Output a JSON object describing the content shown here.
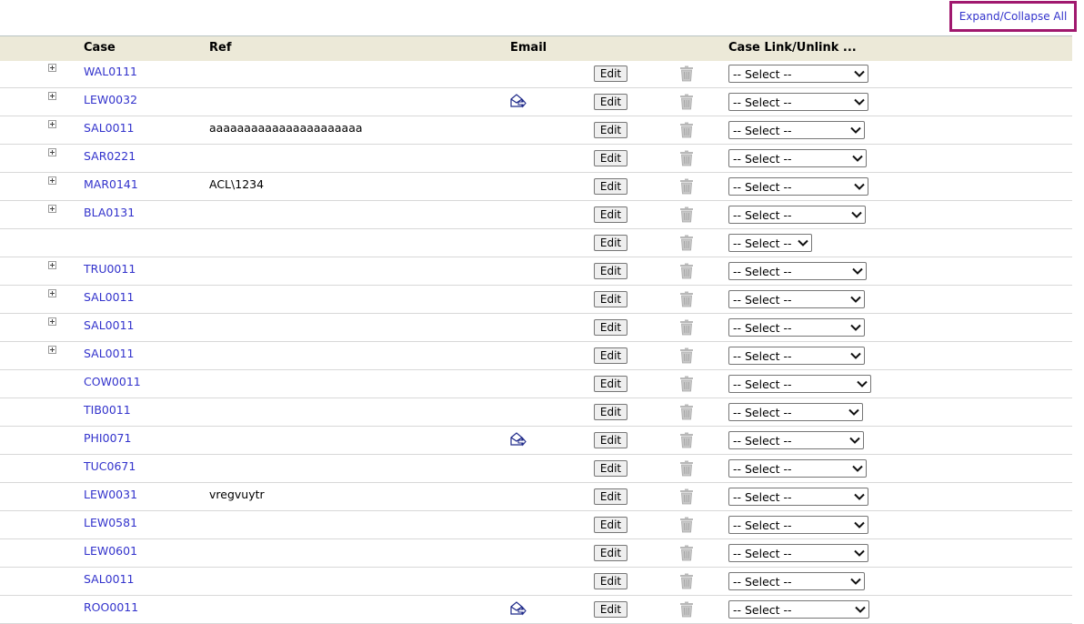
{
  "toolbar": {
    "expand_collapse_label": "Expand/Collapse All"
  },
  "table": {
    "headers": {
      "case": "Case",
      "ref": "Ref",
      "email": "Email",
      "link": "Case Link/Unlink ..."
    },
    "edit_label": "Edit",
    "select_label": "-- Select --",
    "rows": [
      {
        "case": "WAL0111",
        "ref": "",
        "expander": true,
        "email": false
      },
      {
        "case": "LEW0032",
        "ref": "",
        "expander": true,
        "email": true
      },
      {
        "case": "SAL0011",
        "ref": "aaaaaaaaaaaaaaaaaaaaaa",
        "expander": true,
        "email": false
      },
      {
        "case": "SAR0221",
        "ref": "",
        "expander": true,
        "email": false
      },
      {
        "case": "MAR0141",
        "ref": "ACL\\1234",
        "expander": true,
        "email": false
      },
      {
        "case": "BLA0131",
        "ref": "",
        "expander": true,
        "email": false
      },
      {
        "case": "",
        "ref": "",
        "expander": false,
        "email": false
      },
      {
        "case": "TRU0011",
        "ref": "",
        "expander": true,
        "email": false
      },
      {
        "case": "SAL0011",
        "ref": "",
        "expander": true,
        "email": false
      },
      {
        "case": "SAL0011",
        "ref": "",
        "expander": true,
        "email": false
      },
      {
        "case": "SAL0011",
        "ref": "",
        "expander": true,
        "email": false
      },
      {
        "case": "COW0011",
        "ref": "",
        "expander": false,
        "email": false
      },
      {
        "case": "TIB0011",
        "ref": "",
        "expander": false,
        "email": false
      },
      {
        "case": "PHI0071",
        "ref": "",
        "expander": false,
        "email": true
      },
      {
        "case": "TUC0671",
        "ref": "",
        "expander": false,
        "email": false
      },
      {
        "case": "LEW0031",
        "ref": "vregvuytr",
        "expander": false,
        "email": false
      },
      {
        "case": "LEW0581",
        "ref": "",
        "expander": false,
        "email": false
      },
      {
        "case": "LEW0601",
        "ref": "",
        "expander": false,
        "email": false
      },
      {
        "case": "SAL0011",
        "ref": "",
        "expander": false,
        "email": false
      },
      {
        "case": "ROO0011",
        "ref": "",
        "expander": false,
        "email": true
      }
    ]
  },
  "icons": {
    "expander": "plus-box-icon",
    "email": "email-forward-icon",
    "delete": "trash-icon",
    "dropdown": "chevron-down-icon"
  },
  "colors": {
    "link": "#3333cc",
    "header_bg": "#ece9d8",
    "highlight_border": "#a0186e"
  }
}
